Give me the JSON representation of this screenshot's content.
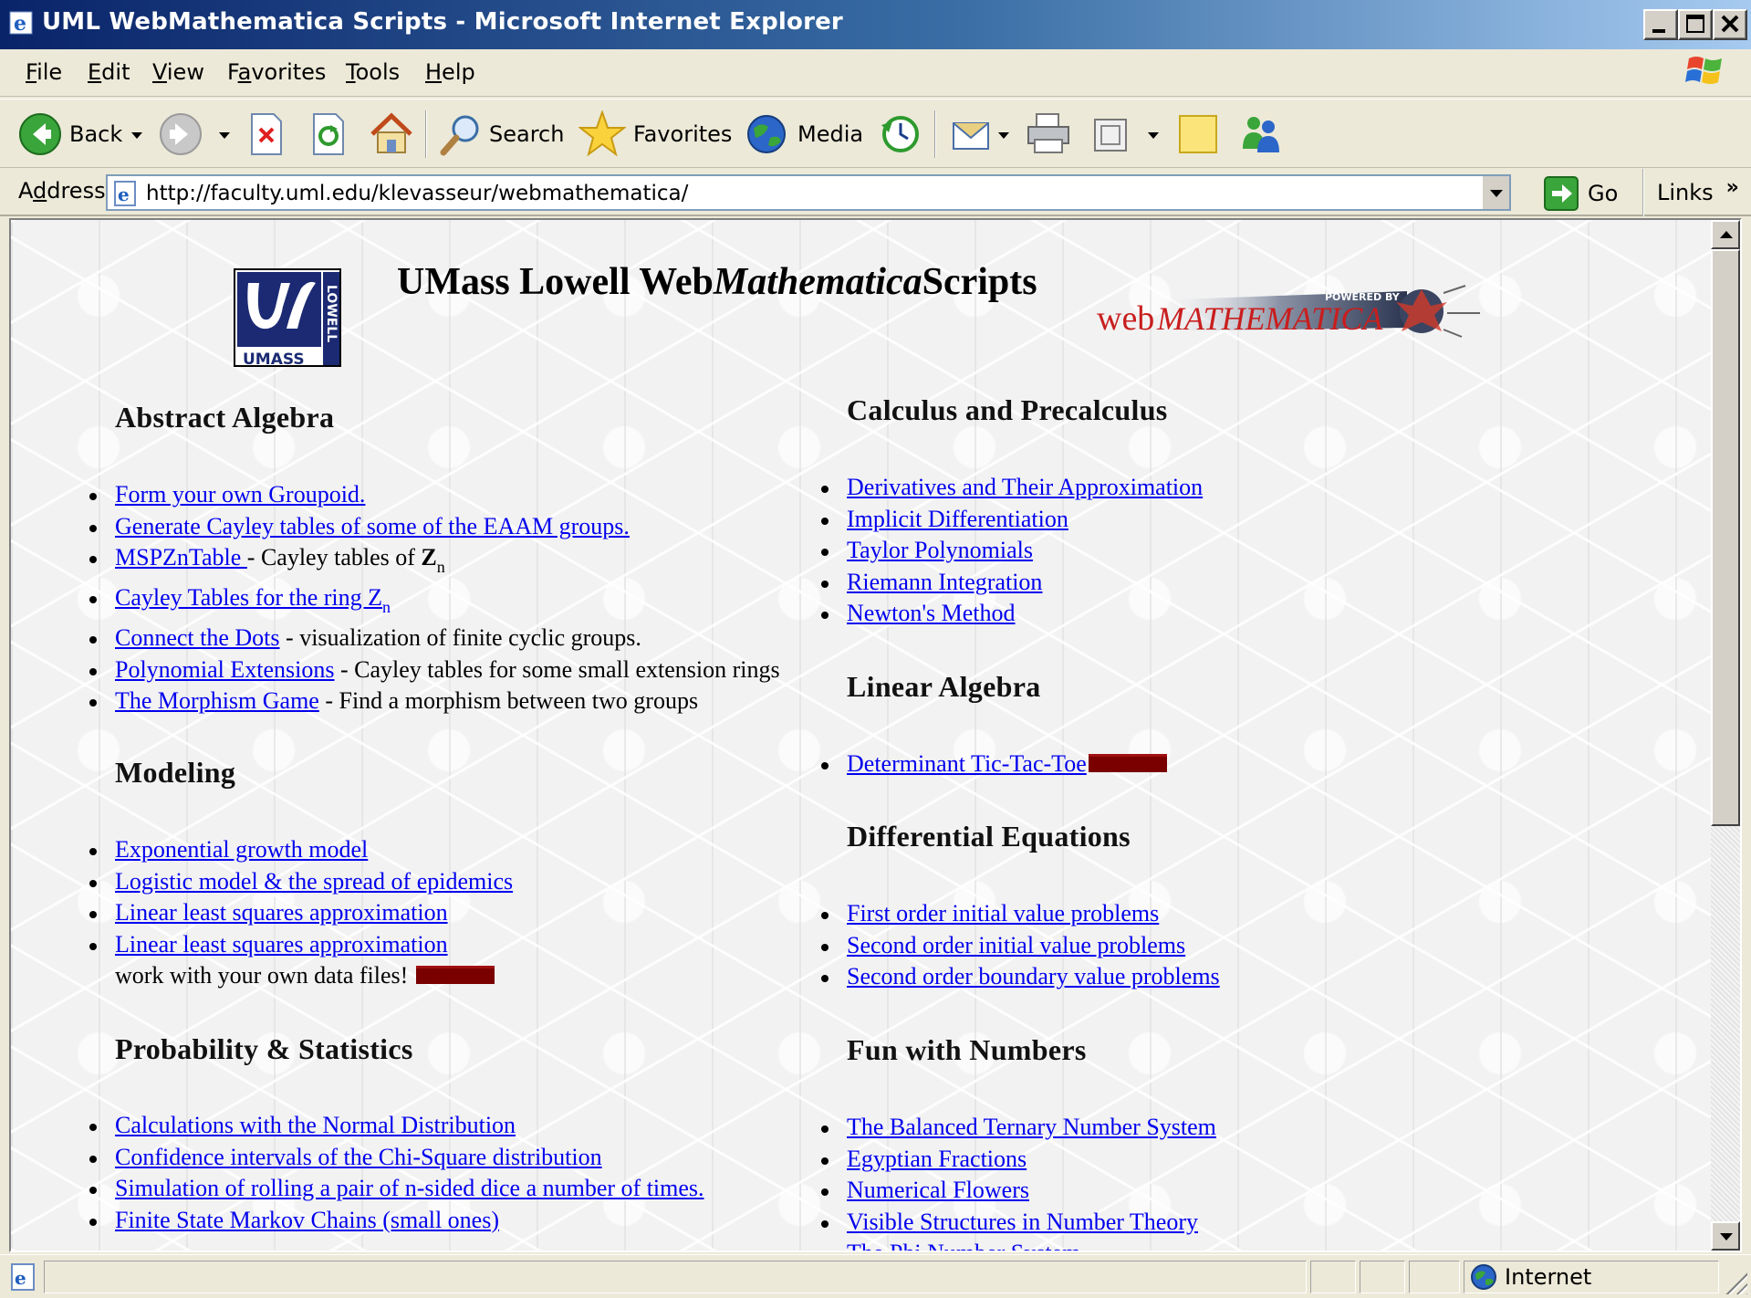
{
  "window": {
    "title": "UML WebMathematica Scripts - Microsoft Internet Explorer"
  },
  "menu": {
    "items": [
      {
        "pre": "",
        "key": "F",
        "post": "ile"
      },
      {
        "pre": "",
        "key": "E",
        "post": "dit"
      },
      {
        "pre": "",
        "key": "V",
        "post": "iew"
      },
      {
        "pre": "F",
        "key": "a",
        "post": "vorites"
      },
      {
        "pre": "",
        "key": "T",
        "post": "ools"
      },
      {
        "pre": "",
        "key": "H",
        "post": "elp"
      }
    ]
  },
  "toolbar": {
    "back_label": "Back",
    "search_label": "Search",
    "favorites_label": "Favorites",
    "media_label": "Media"
  },
  "address": {
    "label_pre": "A",
    "label_key": "d",
    "label_post": "dress",
    "url": "http://faculty.uml.edu/klevasseur/webmathematica/",
    "go_label": "Go",
    "links_label": "Links",
    "links_chevron": "»"
  },
  "page": {
    "title_pre": "UMass Lowell Web",
    "title_italic": "Mathematica",
    "title_post": "Scripts",
    "umass_logo_text": "UMASS",
    "umass_logo_side": "LOWELL",
    "wm_logo_powered": "POWERED BY",
    "wm_logo_web": "web",
    "wm_logo_math": "MATHEMATICA",
    "left": {
      "abstract_algebra": {
        "heading": "Abstract Algebra",
        "items": [
          {
            "link": "Form your own Groupoid.",
            "text": ""
          },
          {
            "link": "Generate Cayley tables of some of the EAAM groups.",
            "text": ""
          },
          {
            "link": "MSPZnTable ",
            "text": "- Cayley tables of "
          },
          {
            "link": "Cayley Tables for the ring Z",
            "text": ""
          },
          {
            "link": "Connect the Dots",
            "text": " - visualization of finite cyclic groups."
          },
          {
            "link": "Polynomial Extensions",
            "text": " - Cayley tables for some small extension rings"
          },
          {
            "link": "The Morphism Game",
            "text": " - Find a morphism between two groups"
          }
        ],
        "z_letter": "Z",
        "n_sub": "n"
      },
      "modeling": {
        "heading": "Modeling",
        "items": [
          {
            "link": "Exponential growth model"
          },
          {
            "link": "Logistic model & the spread of epidemics"
          },
          {
            "link": "Linear least squares approximation"
          },
          {
            "link": "Linear least squares approximation"
          }
        ],
        "continuation": "work with your own data files! "
      },
      "probability": {
        "heading": "Probability & Statistics",
        "items": [
          {
            "link": "Calculations with the Normal Distribution"
          },
          {
            "link": "Confidence intervals of the Chi-Square distribution"
          },
          {
            "link": "Simulation of rolling a pair of n-sided dice a number of times."
          },
          {
            "link": "Finite State Markov Chains (small ones)"
          }
        ]
      }
    },
    "right": {
      "calculus": {
        "heading": "Calculus and Precalculus",
        "items": [
          {
            "link": "Derivatives and Their Approximation"
          },
          {
            "link": "Implicit Differentiation"
          },
          {
            "link": "Taylor Polynomials"
          },
          {
            "link": "Riemann Integration"
          },
          {
            "link": "Newton's Method"
          }
        ]
      },
      "linear_algebra": {
        "heading": "Linear Algebra",
        "items": [
          {
            "link": "Determinant Tic-Tac-Toe"
          }
        ]
      },
      "diffeq": {
        "heading": "Differential Equations",
        "items": [
          {
            "link": "First order initial value problems"
          },
          {
            "link": "Second order initial value problems"
          },
          {
            "link": "Second order boundary value problems"
          }
        ]
      },
      "fun": {
        "heading": "Fun with Numbers",
        "items": [
          {
            "link": "The Balanced Ternary Number System"
          },
          {
            "link": "Egyptian Fractions"
          },
          {
            "link": "Numerical Flowers"
          },
          {
            "link": "Visible Structures in Number Theory"
          },
          {
            "link": "The Phi Number System"
          }
        ]
      }
    }
  },
  "statusbar": {
    "zone_label": "Internet"
  },
  "colors": {
    "link": "#0000ee",
    "new_badge": "#7a0000",
    "titlebar_start": "#0a246a",
    "titlebar_end": "#a6caf0"
  }
}
